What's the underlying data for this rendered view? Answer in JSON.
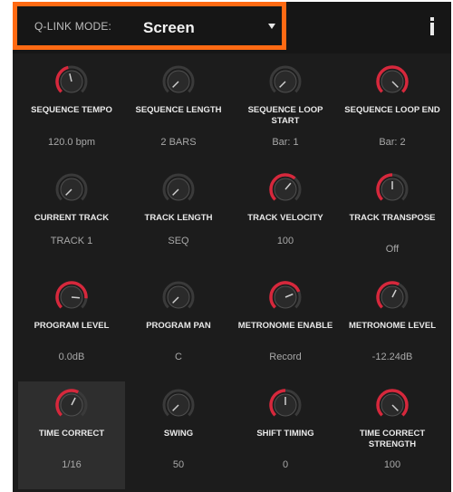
{
  "header": {
    "qlink_label": "Q-LINK MODE:",
    "mode_value": "Screen",
    "info_icon": "info-icon"
  },
  "colors": {
    "accent": "#ff6a13",
    "knob_arc": "#d6283c",
    "panel": "#1c1c1c"
  },
  "params": [
    {
      "name": "SEQUENCE TEMPO",
      "value": "120.0 bpm",
      "level": 0.45
    },
    {
      "name": "SEQUENCE LENGTH",
      "value": "2 BARS",
      "level": 0.0
    },
    {
      "name": "SEQUENCE LOOP START",
      "value": "Bar: 1",
      "level": 0.0
    },
    {
      "name": "SEQUENCE LOOP END",
      "value": "Bar: 2",
      "level": 1.0
    },
    {
      "name": "CURRENT TRACK",
      "value": "TRACK 1",
      "level": 0.0
    },
    {
      "name": "TRACK LENGTH",
      "value": "SEQ",
      "level": 0.0
    },
    {
      "name": "TRACK VELOCITY",
      "value": "100",
      "level": 0.65
    },
    {
      "name": "TRACK TRANSPOSE",
      "value": "Off",
      "level": 0.5
    },
    {
      "name": "PROGRAM LEVEL",
      "value": "0.0dB",
      "level": 0.85
    },
    {
      "name": "PROGRAM PAN",
      "value": "C",
      "level": 0.0
    },
    {
      "name": "METRONOME ENABLE",
      "value": "Record",
      "level": 0.75
    },
    {
      "name": "METRONOME LEVEL",
      "value": "-12.24dB",
      "level": 0.6
    },
    {
      "name": "TIME CORRECT",
      "value": "1/16",
      "level": 0.6
    },
    {
      "name": "SWING",
      "value": "50",
      "level": 0.0
    },
    {
      "name": "SHIFT TIMING",
      "value": "0",
      "level": 0.5
    },
    {
      "name": "TIME CORRECT STRENGTH",
      "value": "100",
      "level": 1.0
    }
  ]
}
